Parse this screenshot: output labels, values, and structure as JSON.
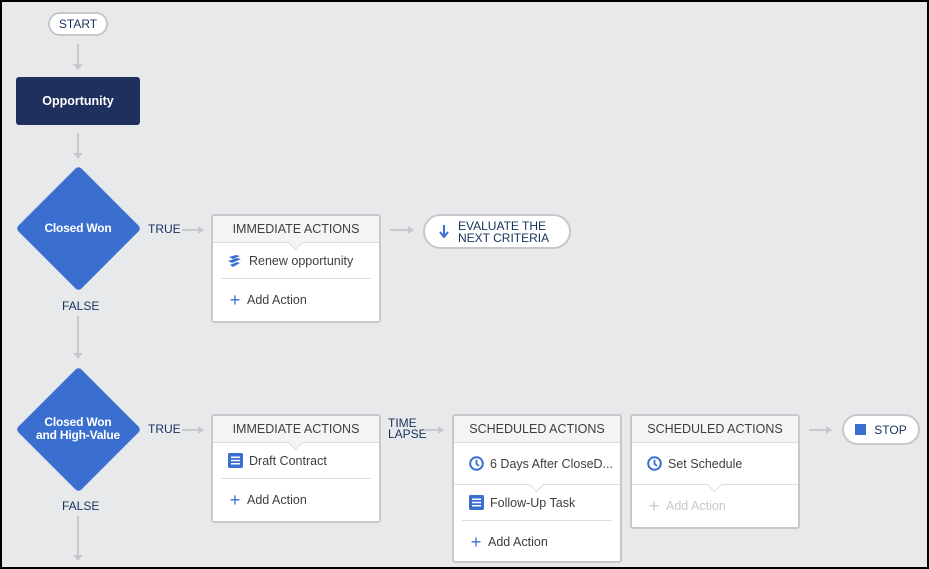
{
  "diagram": {
    "start_label": "START",
    "object_node": {
      "label": "Opportunity"
    },
    "criteria": [
      {
        "label": "Closed Won",
        "true_label": "TRUE",
        "false_label": "FALSE",
        "immediate_actions": {
          "header": "IMMEDIATE ACTIONS",
          "items": [
            {
              "icon": "flow-icon",
              "label": "Renew opportunity"
            }
          ],
          "add_label": "Add Action"
        },
        "next": {
          "icon": "arrow-down-icon",
          "label_line1": "EVALUATE THE",
          "label_line2": "NEXT CRITERIA"
        }
      },
      {
        "label_line1": "Closed Won",
        "label_line2": "and High-Value",
        "true_label": "TRUE",
        "false_label": "FALSE",
        "immediate_actions": {
          "header": "IMMEDIATE ACTIONS",
          "items": [
            {
              "icon": "task-icon",
              "label": "Draft Contract"
            }
          ],
          "add_label": "Add Action"
        },
        "time_lapse_label_line1": "TIME",
        "time_lapse_label_line2": "LAPSE",
        "scheduled_actions": [
          {
            "header": "SCHEDULED ACTIONS",
            "schedule": {
              "icon": "clock-icon",
              "label": "6 Days After CloseD..."
            },
            "items": [
              {
                "icon": "task-icon",
                "label": "Follow-Up Task"
              }
            ],
            "add_label": "Add Action"
          },
          {
            "header": "SCHEDULED ACTIONS",
            "schedule": {
              "icon": "clock-icon",
              "label": "Set Schedule"
            },
            "items": [],
            "add_label": "Add Action",
            "add_disabled": true
          }
        ],
        "next": {
          "icon": "stop-icon",
          "label": "STOP"
        }
      }
    ]
  },
  "colors": {
    "background": "#e8e9eb",
    "object_node": "#1f305e",
    "criteria_node": "#3b6fcf",
    "connector": "#c6c8cb",
    "text_dark": "#16325c",
    "accent": "#3b6fcf"
  }
}
